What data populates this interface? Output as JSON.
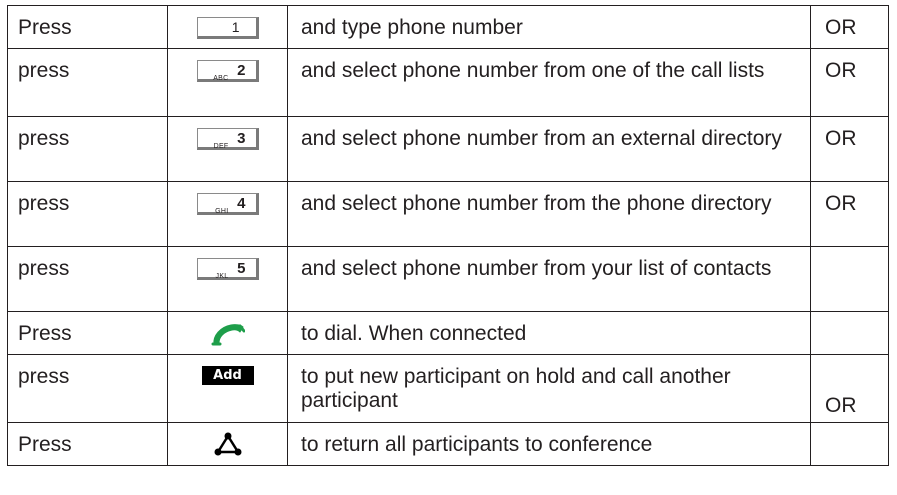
{
  "rows": [
    {
      "verb": "Press",
      "key": {
        "type": "digit",
        "letters": "",
        "digit": "1",
        "icon": "key-1-icon"
      },
      "description": "and type phone number",
      "or": "OR"
    },
    {
      "verb": "press",
      "key": {
        "type": "digit",
        "letters": "ABC",
        "digit": "2",
        "icon": "key-2-abc-icon"
      },
      "description": "and select phone number from one of the call lists",
      "or": "OR"
    },
    {
      "verb": "press",
      "key": {
        "type": "digit",
        "letters": "DEF",
        "digit": "3",
        "icon": "key-3-def-icon"
      },
      "description": "and select phone number from an external directory",
      "or": "OR"
    },
    {
      "verb": "press",
      "key": {
        "type": "digit",
        "letters": "GHI",
        "digit": "4",
        "icon": "key-4-ghi-icon"
      },
      "description": "and select phone number from the phone directory",
      "or": "OR"
    },
    {
      "verb": "press",
      "key": {
        "type": "digit",
        "letters": "JKL",
        "digit": "5",
        "icon": "key-5-jkl-icon"
      },
      "description": "and select phone number from your list of contacts",
      "or": ""
    },
    {
      "verb": "Press",
      "key": {
        "type": "handset",
        "icon": "green-handset-icon",
        "color": "#1e9e4a"
      },
      "description": "to dial. When connected",
      "or": ""
    },
    {
      "verb": "press",
      "key": {
        "type": "softkey",
        "label": "Add",
        "icon": "add-softkey-icon"
      },
      "description": "to put new participant on hold and call another participant",
      "or": "OR"
    },
    {
      "verb": "Press",
      "key": {
        "type": "conference",
        "icon": "conference-icon"
      },
      "description": "to return all participants to conference",
      "or": ""
    }
  ]
}
